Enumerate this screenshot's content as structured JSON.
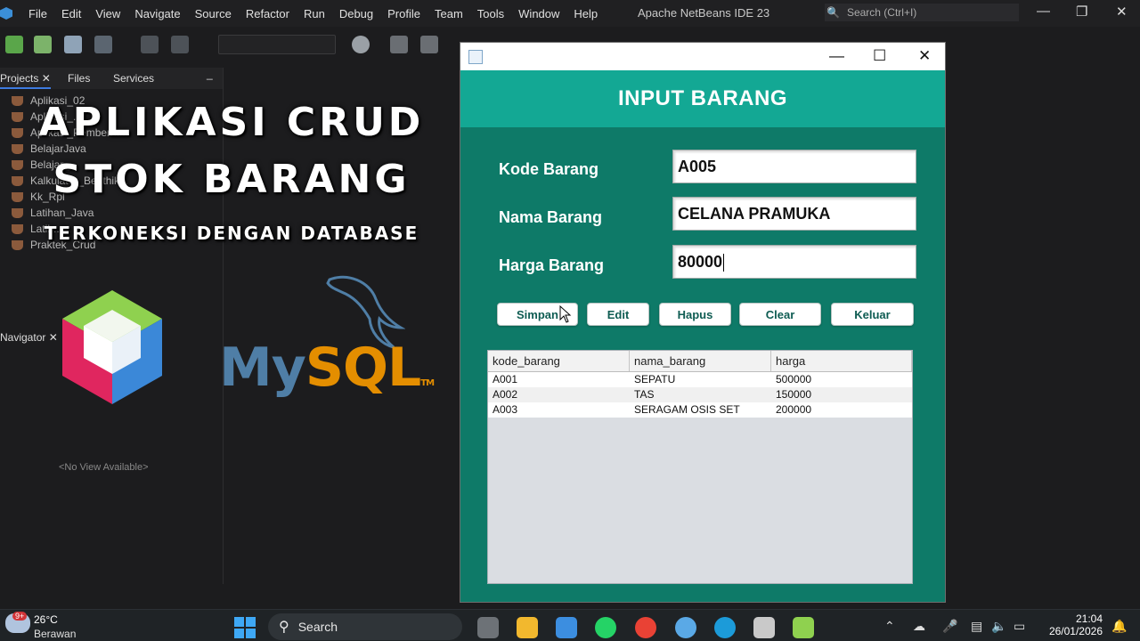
{
  "ide": {
    "menu": [
      "File",
      "Edit",
      "View",
      "Navigate",
      "Source",
      "Refactor",
      "Run",
      "Debug",
      "Profile",
      "Team",
      "Tools",
      "Window",
      "Help"
    ],
    "title": "Apache NetBeans IDE 23",
    "search_placeholder": "Search (Ctrl+I)",
    "panel_tabs": [
      "Projects",
      "Files",
      "Services"
    ],
    "projects": [
      "Aplikasi_02",
      "Aplikasi_...",
      "Aplikasi_Pemberh...",
      "BelajarJava",
      "Belajar_...",
      "Kalkulator_Benthik...",
      "Kk_Rpl",
      "Latihan_Java",
      "Latih...",
      "Praktek_Crud"
    ],
    "navigator_label": "Navigator",
    "no_view": "<No View Available>"
  },
  "overlay": {
    "line1": "APLIKASI CRUD",
    "line2": "STOK BARANG",
    "line3": "TERKONEKSI DENGAN DATABASE",
    "mysql_my": "My",
    "mysql_sql": "SQL",
    "mysql_tm": "TM"
  },
  "app": {
    "header": "INPUT BARANG",
    "fields": {
      "kode_label": "Kode Barang",
      "kode_value": "A005",
      "nama_label": "Nama Barang",
      "nama_value": "CELANA PRAMUKA",
      "harga_label": "Harga Barang",
      "harga_value": "80000"
    },
    "buttons": {
      "simpan": "Simpan",
      "edit": "Edit",
      "hapus": "Hapus",
      "clear": "Clear",
      "keluar": "Keluar"
    },
    "table": {
      "columns": [
        "kode_barang",
        "nama_barang",
        "harga"
      ],
      "rows": [
        [
          "A001",
          "SEPATU",
          "500000"
        ],
        [
          "A002",
          "TAS",
          "150000"
        ],
        [
          "A003",
          "SERAGAM OSIS SET",
          "200000"
        ]
      ]
    }
  },
  "taskbar": {
    "badge": "9+",
    "temperature": "26°C",
    "weather": "Berawan",
    "search_label": "Search",
    "time": "21:04",
    "date": "26/01/2026"
  }
}
